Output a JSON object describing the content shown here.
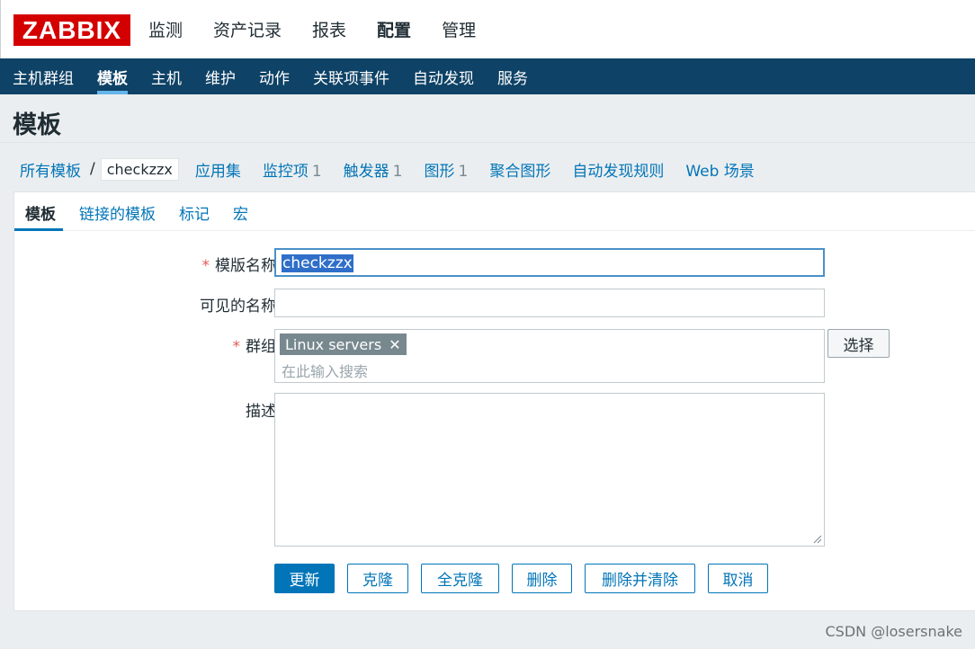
{
  "logo": "ZABBIX",
  "main_menu": [
    "监测",
    "资产记录",
    "报表",
    "配置",
    "管理"
  ],
  "main_menu_selected": "配置",
  "sub_menu": [
    "主机群组",
    "模板",
    "主机",
    "维护",
    "动作",
    "关联项事件",
    "自动发现",
    "服务"
  ],
  "sub_menu_selected": "模板",
  "page_title": "模板",
  "nav": {
    "breadcrumb_root": "所有模板",
    "breadcrumb_sep": "/",
    "breadcrumb_current": "checkzzx",
    "applications": "应用集",
    "items": "监控项",
    "items_count": "1",
    "triggers": "触发器",
    "triggers_count": "1",
    "graphs": "图形",
    "graphs_count": "1",
    "screens": "聚合图形",
    "discovery": "自动发现规则",
    "web": "Web 场景"
  },
  "tabs": [
    "模板",
    "链接的模板",
    "标记",
    "宏"
  ],
  "form": {
    "required_mark": "*",
    "name_label": "模版名称",
    "name_value": "checkzzx",
    "visible_label": "可见的名称",
    "visible_value": "",
    "groups_label": "群组",
    "group_chip": "Linux servers",
    "chip_remove": "✕",
    "groups_placeholder": "在此输入搜索",
    "select_button": "选择",
    "desc_label": "描述",
    "desc_value": ""
  },
  "buttons": {
    "update": "更新",
    "clone": "克隆",
    "full_clone": "全克隆",
    "delete": "删除",
    "delete_clear": "删除并清除",
    "cancel": "取消"
  },
  "watermark": "CSDN @losersnake",
  "colors": {
    "logo_bg": "#d40000",
    "subbar_bg": "#0e4266",
    "link": "#0275b8"
  }
}
